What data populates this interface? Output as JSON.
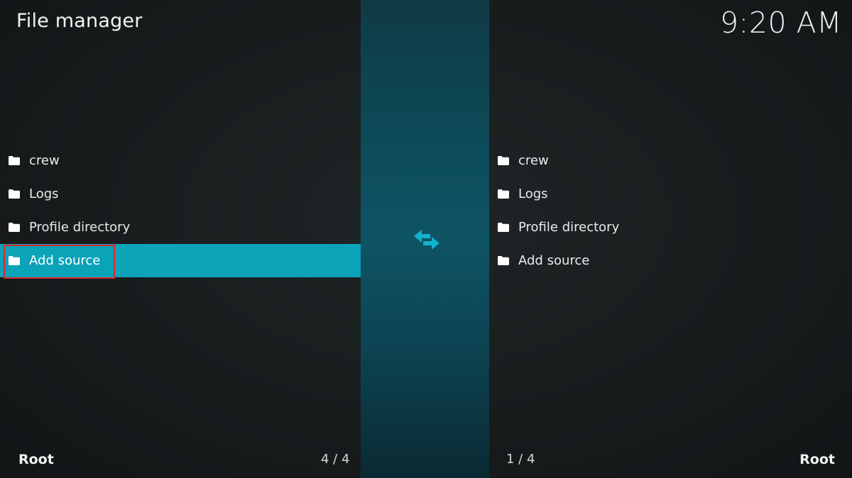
{
  "header": {
    "title": "File manager",
    "clock": "9:20 AM"
  },
  "left_pane": {
    "items": [
      {
        "label": "crew",
        "icon": "folder-icon"
      },
      {
        "label": "Logs",
        "icon": "folder-icon"
      },
      {
        "label": "Profile directory",
        "icon": "folder-icon"
      },
      {
        "label": "Add source",
        "icon": "folder-icon",
        "selected": true
      }
    ],
    "footer_path": "Root",
    "footer_count": "4 / 4"
  },
  "right_pane": {
    "items": [
      {
        "label": "crew",
        "icon": "folder-icon"
      },
      {
        "label": "Logs",
        "icon": "folder-icon"
      },
      {
        "label": "Profile directory",
        "icon": "folder-icon"
      },
      {
        "label": "Add source",
        "icon": "folder-icon"
      }
    ],
    "footer_path": "Root",
    "footer_count": "1 / 4"
  },
  "center": {
    "icon": "swap-arrows-icon"
  },
  "colors": {
    "selection": "#0aa3b8",
    "accent_icon": "#12b2cc",
    "annotation_box": "#d9262c",
    "center_strip": "#0e5464"
  }
}
